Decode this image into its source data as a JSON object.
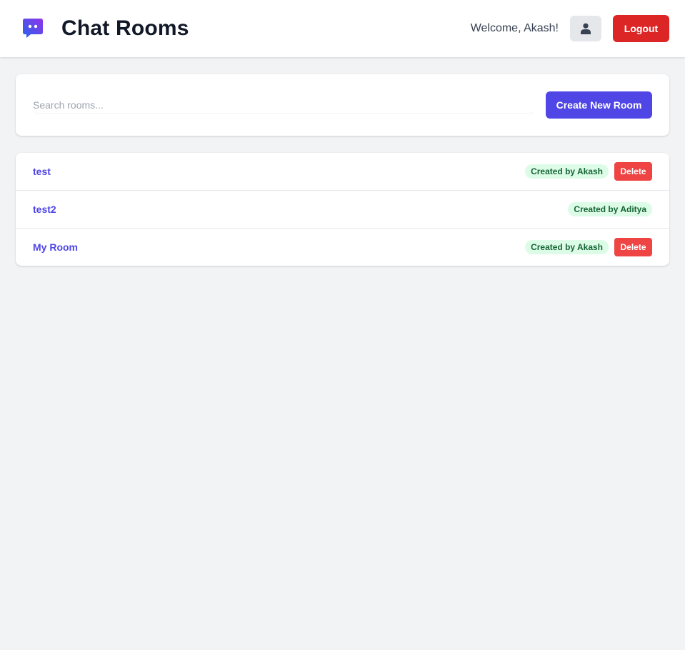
{
  "header": {
    "title": "Chat Rooms",
    "welcome": "Welcome, Akash!",
    "logout_label": "Logout",
    "logo_icon": "chat-bubble-icon",
    "avatar_icon": "user-icon"
  },
  "search": {
    "placeholder": "Search rooms...",
    "value": ""
  },
  "create_button": "Create New Room",
  "rooms": [
    {
      "name": "test",
      "badge": "Created by Akash",
      "delete_label": "Delete"
    },
    {
      "name": "test2",
      "badge": "Created by Aditya"
    },
    {
      "name": "My Room",
      "badge": "Created by Akash",
      "delete_label": "Delete"
    }
  ],
  "colors": {
    "accent": "#4f46e5",
    "danger": "#dc2626",
    "delete": "#ef4444",
    "badge_bg": "#dcfce7",
    "badge_text": "#166534"
  }
}
